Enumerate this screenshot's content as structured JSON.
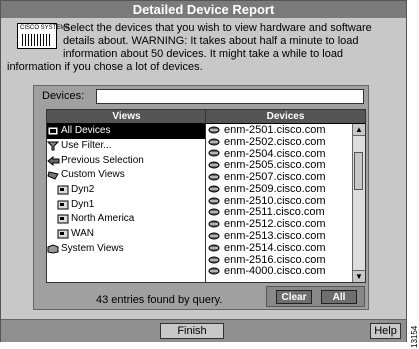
{
  "window": {
    "title": "Detailed Device Report"
  },
  "info": {
    "logo_text": "CISCO SYSTEMS",
    "message": "Select the devices that you wish to view hardware and software details about. WARNING: It takes about half a minute to load information about 50 devices. It might take a while to load information if you chose a lot of devices."
  },
  "devices_field": {
    "label": "Devices:",
    "value": ""
  },
  "views": {
    "header": "Views",
    "items": [
      {
        "label": "All Devices",
        "icon": "all-devices-icon",
        "selected": true
      },
      {
        "label": "Use Filter...",
        "icon": "filter-icon"
      },
      {
        "label": "Previous Selection",
        "icon": "back-arrow-icon"
      },
      {
        "label": "Custom Views",
        "icon": "custom-views-icon"
      },
      {
        "label": "Dyn2",
        "icon": "view-icon"
      },
      {
        "label": "Dyn1",
        "icon": "view-icon"
      },
      {
        "label": "North America",
        "icon": "view-icon"
      },
      {
        "label": "WAN",
        "icon": "view-icon"
      },
      {
        "label": "System Views",
        "icon": "system-views-icon"
      }
    ]
  },
  "devices": {
    "header": "Devices",
    "items": [
      "enm-2501.cisco.com",
      "enm-2502.cisco.com",
      "enm-2504.cisco.com",
      "enm-2505.cisco.com",
      "enm-2507.cisco.com",
      "enm-2509.cisco.com",
      "enm-2510.cisco.com",
      "enm-2511.cisco.com",
      "enm-2512.cisco.com",
      "enm-2513.cisco.com",
      "enm-2514.cisco.com",
      "enm-2516.cisco.com",
      "enm-4000.cisco.com"
    ]
  },
  "status": {
    "count_text": "43 entries found by query."
  },
  "buttons": {
    "clear": "Clear",
    "all": "All",
    "finish": "Finish",
    "help": "Help"
  },
  "figure_number": "13154"
}
